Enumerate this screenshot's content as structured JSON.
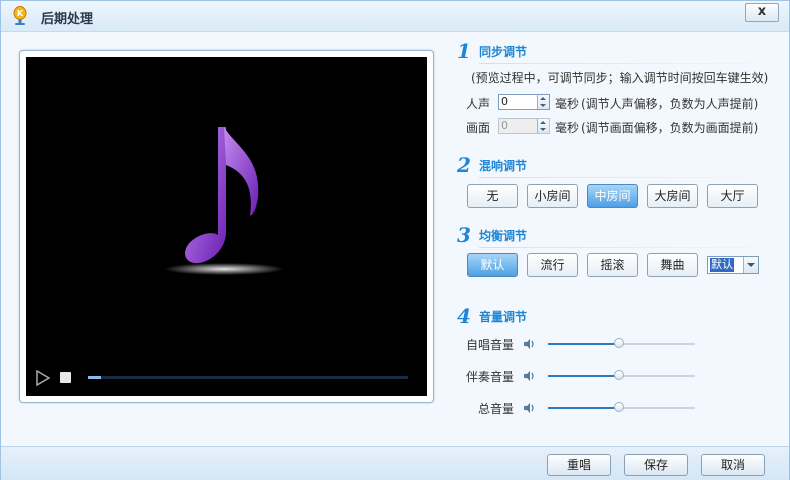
{
  "window": {
    "title": "后期处理",
    "close_label": "x"
  },
  "player": {
    "progress": 0.04
  },
  "sync": {
    "number": "1",
    "title": "同步调节",
    "hint": "(预览过程中，可调节同步；输入调节时间按回车键生效)",
    "voice": {
      "label": "人声",
      "value": "0",
      "unit": "毫秒",
      "desc": "(调节人声偏移，负数为人声提前)"
    },
    "video": {
      "label": "画面",
      "value": "0",
      "unit": "毫秒",
      "desc": "(调节画面偏移，负数为画面提前)"
    }
  },
  "reverb": {
    "number": "2",
    "title": "混响调节",
    "options": [
      "无",
      "小房间",
      "中房间",
      "大房间",
      "大厅"
    ],
    "selected": "中房间"
  },
  "eq": {
    "number": "3",
    "title": "均衡调节",
    "options": [
      "默认",
      "流行",
      "摇滚",
      "舞曲"
    ],
    "selected": "默认",
    "combo_value": "默认"
  },
  "volume": {
    "number": "4",
    "title": "音量调节",
    "sliders": [
      {
        "label": "自唱音量",
        "level": 0.48
      },
      {
        "label": "伴奏音量",
        "level": 0.48
      },
      {
        "label": "总音量",
        "level": 0.48
      }
    ]
  },
  "footer": {
    "resing_label": "重唱",
    "save_label": "保存",
    "cancel_label": "取消"
  },
  "colors": {
    "accent": "#1f86d6",
    "active_button": "#4ea0e3",
    "note": "#8a3fd0"
  }
}
